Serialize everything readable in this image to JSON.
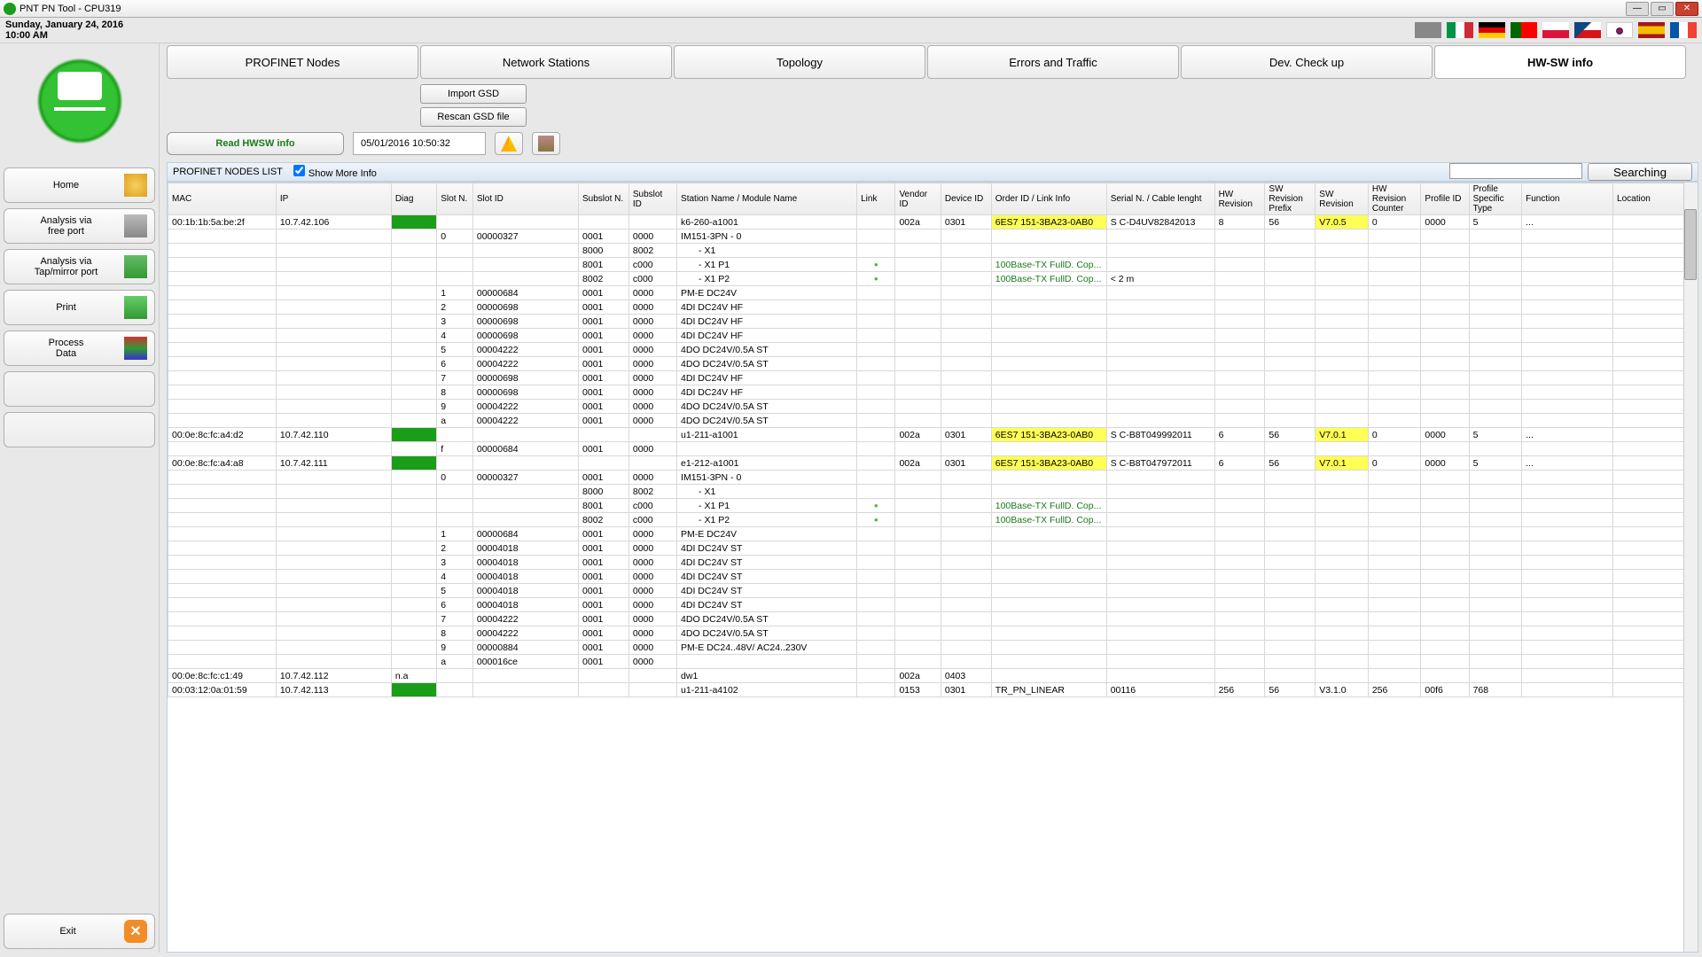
{
  "window": {
    "title": "PNT PN Tool - CPU319"
  },
  "datetime": {
    "date": "Sunday, January 24, 2016",
    "time": "10:00 AM"
  },
  "sidebar": {
    "home": "Home",
    "free_port": "Analysis via\nfree port",
    "tap": "Analysis via\nTap/mirror port",
    "print": "Print",
    "process_data": "Process\nData",
    "exit": "Exit"
  },
  "tabs": {
    "t0": "PROFINET Nodes",
    "t1": "Network Stations",
    "t2": "Topology",
    "t3": "Errors and Traffic",
    "t4": "Dev. Check up",
    "t5": "HW-SW info"
  },
  "buttons": {
    "import_gsd": "Import GSD",
    "rescan_gsd": "Rescan GSD file",
    "read_hwsw": "Read HWSW info",
    "searching": "Searching"
  },
  "timestamp": "05/01/2016  10:50:32",
  "listheader": {
    "title": "PROFINET NODES LIST",
    "showmore": "Show More Info"
  },
  "columns": {
    "mac": "MAC",
    "ip": "IP",
    "diag": "Diag",
    "slotn": "Slot N.",
    "slotid": "Slot ID",
    "subsn": "Subslot N.",
    "subsid": "Subslot ID",
    "name": "Station Name / Module Name",
    "link": "Link",
    "vend": "Vendor ID",
    "dev": "Device ID",
    "order": "Order ID / Link Info",
    "serial": "Serial N. / Cable lenght",
    "hwrev": "HW Revision",
    "swpre": "SW Revision Prefix",
    "swrev": "SW Revision",
    "hwcnt": "HW Revision Counter",
    "profid": "Profile ID",
    "proft": "Profile Specific Type",
    "func": "Function",
    "loc": "Location"
  },
  "rows": [
    {
      "mac": "00:1b:1b:5a:be:2f",
      "ip": "10.7.42.106",
      "diag": "ok",
      "name": "k6-260-a1001",
      "vend": "002a",
      "dev": "0301",
      "order": "6ES7 151-3BA23-0AB0",
      "order_hl": true,
      "serial": "S C-D4UV82842013",
      "hwrev": "8",
      "swpre": "56",
      "swrev": "V7.0.5",
      "swrev_hl": true,
      "hwcnt": "0",
      "profid": "0000",
      "proft": "5",
      "func": "...",
      "loc": ""
    },
    {
      "slotn": "0",
      "slotid": "00000327",
      "subsn": "0001",
      "subsid": "0000",
      "name": "IM151-3PN - 0"
    },
    {
      "subsn": "8000",
      "subsid": "8002",
      "name": "     - X1"
    },
    {
      "subsn": "8001",
      "subsid": "c000",
      "name": "     - X1 P1",
      "link": "o",
      "order": "100Base-TX FullD. Cop...",
      "order_g": true
    },
    {
      "subsn": "8002",
      "subsid": "c000",
      "name": "     - X1 P2",
      "link": "o",
      "order": "100Base-TX FullD. Cop...",
      "order_g": true,
      "serial": "< 2 m"
    },
    {
      "slotn": "1",
      "slotid": "00000684",
      "subsn": "0001",
      "subsid": "0000",
      "name": "PM-E DC24V"
    },
    {
      "slotn": "2",
      "slotid": "00000698",
      "subsn": "0001",
      "subsid": "0000",
      "name": "4DI DC24V HF"
    },
    {
      "slotn": "3",
      "slotid": "00000698",
      "subsn": "0001",
      "subsid": "0000",
      "name": "4DI DC24V HF"
    },
    {
      "slotn": "4",
      "slotid": "00000698",
      "subsn": "0001",
      "subsid": "0000",
      "name": "4DI DC24V HF"
    },
    {
      "slotn": "5",
      "slotid": "00004222",
      "subsn": "0001",
      "subsid": "0000",
      "name": "4DO DC24V/0.5A ST"
    },
    {
      "slotn": "6",
      "slotid": "00004222",
      "subsn": "0001",
      "subsid": "0000",
      "name": "4DO DC24V/0.5A ST"
    },
    {
      "slotn": "7",
      "slotid": "00000698",
      "subsn": "0001",
      "subsid": "0000",
      "name": "4DI DC24V HF"
    },
    {
      "slotn": "8",
      "slotid": "00000698",
      "subsn": "0001",
      "subsid": "0000",
      "name": "4DI DC24V HF"
    },
    {
      "slotn": "9",
      "slotid": "00004222",
      "subsn": "0001",
      "subsid": "0000",
      "name": "4DO DC24V/0.5A ST"
    },
    {
      "slotn": "a",
      "slotid": "00004222",
      "subsn": "0001",
      "subsid": "0000",
      "name": "4DO DC24V/0.5A ST"
    },
    {
      "mac": "00:0e:8c:fc:a4:d2",
      "ip": "10.7.42.110",
      "diag": "ok",
      "name": "u1-211-a1001",
      "vend": "002a",
      "dev": "0301",
      "order": "6ES7 151-3BA23-0AB0",
      "order_hl": true,
      "serial": "S C-B8T049992011",
      "hwrev": "6",
      "swpre": "56",
      "swrev": "V7.0.1",
      "swrev_hl": true,
      "hwcnt": "0",
      "profid": "0000",
      "proft": "5",
      "func": "...",
      "loc": ""
    },
    {
      "slotn": "f",
      "slotid": "00000684",
      "subsn": "0001",
      "subsid": "0000"
    },
    {
      "mac": "00:0e:8c:fc:a4:a8",
      "ip": "10.7.42.111",
      "diag": "ok",
      "name": "e1-212-a1001",
      "vend": "002a",
      "dev": "0301",
      "order": "6ES7 151-3BA23-0AB0",
      "order_hl": true,
      "serial": "S C-B8T047972011",
      "hwrev": "6",
      "swpre": "56",
      "swrev": "V7.0.1",
      "swrev_hl": true,
      "hwcnt": "0",
      "profid": "0000",
      "proft": "5",
      "func": "...",
      "loc": ""
    },
    {
      "slotn": "0",
      "slotid": "00000327",
      "subsn": "0001",
      "subsid": "0000",
      "name": "IM151-3PN - 0"
    },
    {
      "subsn": "8000",
      "subsid": "8002",
      "name": "     - X1"
    },
    {
      "subsn": "8001",
      "subsid": "c000",
      "name": "     - X1 P1",
      "link": "o",
      "order": "100Base-TX FullD. Cop...",
      "order_g": true
    },
    {
      "subsn": "8002",
      "subsid": "c000",
      "name": "     - X1 P2",
      "link": "o",
      "order": "100Base-TX FullD. Cop...",
      "order_g": true
    },
    {
      "slotn": "1",
      "slotid": "00000684",
      "subsn": "0001",
      "subsid": "0000",
      "name": "PM-E DC24V"
    },
    {
      "slotn": "2",
      "slotid": "00004018",
      "subsn": "0001",
      "subsid": "0000",
      "name": "4DI DC24V ST"
    },
    {
      "slotn": "3",
      "slotid": "00004018",
      "subsn": "0001",
      "subsid": "0000",
      "name": "4DI DC24V ST"
    },
    {
      "slotn": "4",
      "slotid": "00004018",
      "subsn": "0001",
      "subsid": "0000",
      "name": "4DI DC24V ST"
    },
    {
      "slotn": "5",
      "slotid": "00004018",
      "subsn": "0001",
      "subsid": "0000",
      "name": "4DI DC24V ST"
    },
    {
      "slotn": "6",
      "slotid": "00004018",
      "subsn": "0001",
      "subsid": "0000",
      "name": "4DI DC24V ST"
    },
    {
      "slotn": "7",
      "slotid": "00004222",
      "subsn": "0001",
      "subsid": "0000",
      "name": "4DO DC24V/0.5A ST"
    },
    {
      "slotn": "8",
      "slotid": "00004222",
      "subsn": "0001",
      "subsid": "0000",
      "name": "4DO DC24V/0.5A ST"
    },
    {
      "slotn": "9",
      "slotid": "00000884",
      "subsn": "0001",
      "subsid": "0000",
      "name": "PM-E DC24..48V/ AC24..230V"
    },
    {
      "slotn": "a",
      "slotid": "000016ce",
      "subsn": "0001",
      "subsid": "0000"
    },
    {
      "mac": "00:0e:8c:fc:c1:49",
      "ip": "10.7.42.112",
      "diag": "na",
      "diagtxt": "n.a",
      "name": "dw1",
      "vend": "002a",
      "dev": "0403"
    },
    {
      "mac": "00:03:12:0a:01:59",
      "ip": "10.7.42.113",
      "diag": "ok",
      "name": "u1-211-a4102",
      "vend": "0153",
      "dev": "0301",
      "order": "TR_PN_LINEAR",
      "serial": "00116",
      "hwrev": "256",
      "swpre": "56",
      "swrev": "V3.1.0",
      "hwcnt": "256",
      "profid": "00f6",
      "proft": "768"
    }
  ]
}
